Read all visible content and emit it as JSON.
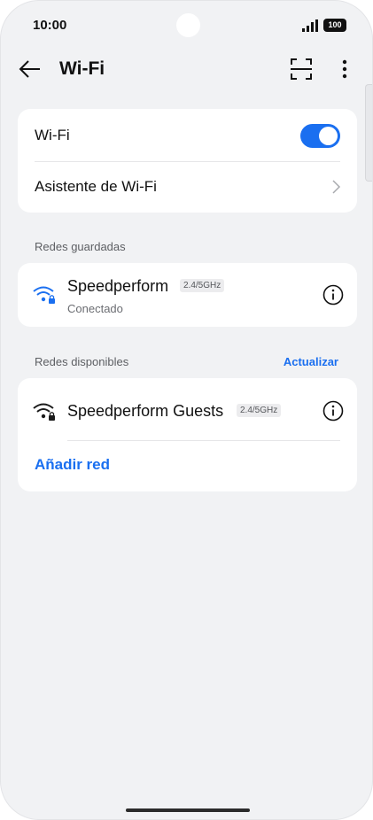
{
  "status_bar": {
    "time": "10:00",
    "battery": "100"
  },
  "app_bar": {
    "title": "Wi-Fi",
    "back_icon": "arrow-left-icon",
    "scan_icon": "scan-icon",
    "more_icon": "more-vertical-icon"
  },
  "wifi_card": {
    "toggle_label": "Wi-Fi",
    "toggle_on": true,
    "assistant_label": "Asistente de Wi-Fi"
  },
  "saved_networks": {
    "section_title": "Redes guardadas",
    "items": [
      {
        "name": "Speedperform",
        "band": "2.4/5GHz",
        "status": "Conectado",
        "icon": "wifi-lock-icon",
        "icon_color": "#1a6ff0"
      }
    ]
  },
  "available_networks": {
    "section_title": "Redes disponibles",
    "refresh_label": "Actualizar",
    "items": [
      {
        "name": "Speedperform Guests",
        "band": "2.4/5GHz",
        "icon": "wifi-lock-icon",
        "icon_color": "#1a1a1a"
      }
    ],
    "add_network_label": "Añadir red"
  },
  "colors": {
    "accent": "#1a6ff0",
    "background": "#f1f2f4",
    "card": "#ffffff"
  }
}
